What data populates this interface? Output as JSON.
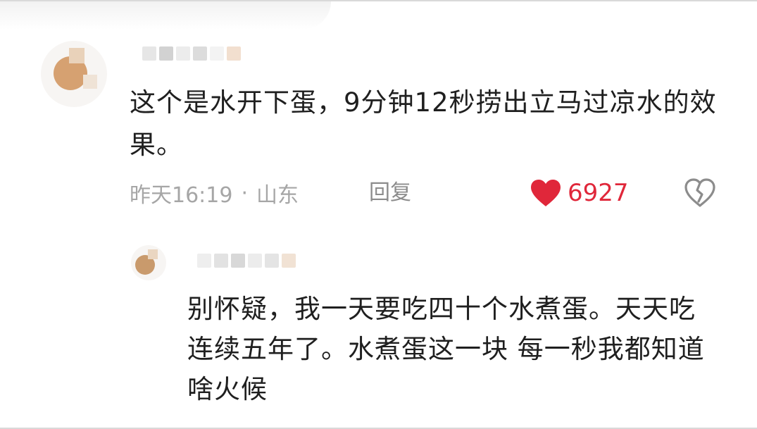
{
  "comment": {
    "text": "这个是水开下蛋，9分钟12秒捞出立马过凉水的效果。",
    "time": "昨天16:19",
    "dot": "·",
    "location": "山东",
    "reply_label": "回复",
    "like_count": "6927",
    "liked": true,
    "colors": {
      "like": "#e0273a",
      "meta": "#a6a6a6",
      "text": "#1f1f1f"
    }
  },
  "reply": {
    "text": "别怀疑，我一天要吃四十个水煮蛋。天天吃 连续五年了。水煮蛋这一块 每一秒我都知道啥火候"
  },
  "icons": {
    "like": "heart-filled-icon",
    "dislike": "broken-heart-icon"
  }
}
